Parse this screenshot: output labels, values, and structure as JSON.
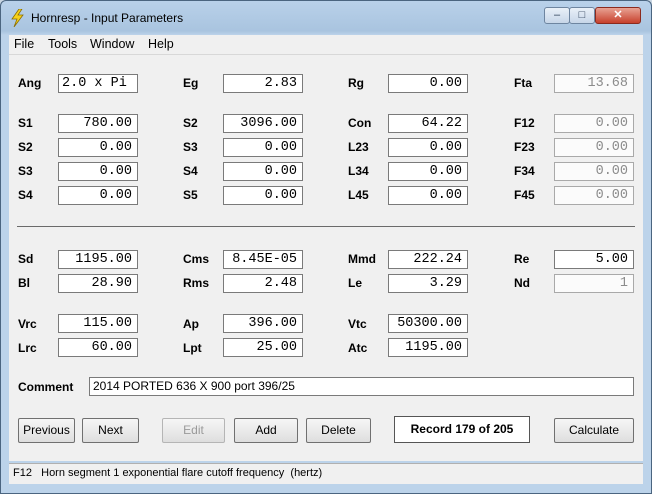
{
  "window": {
    "title": "Hornresp - Input Parameters"
  },
  "menu": [
    "File",
    "Tools",
    "Window",
    "Help"
  ],
  "row1": [
    {
      "label": "Ang",
      "value": "2.0 x Pi"
    },
    {
      "label": "Eg",
      "value": "2.83"
    },
    {
      "label": "Rg",
      "value": "0.00"
    },
    {
      "label": "Fta",
      "value": "13.68"
    }
  ],
  "horn": {
    "col1": [
      {
        "label": "S1",
        "value": "780.00"
      },
      {
        "label": "S2",
        "value": "0.00"
      },
      {
        "label": "S3",
        "value": "0.00"
      },
      {
        "label": "S4",
        "value": "0.00"
      }
    ],
    "col2": [
      {
        "label": "S2",
        "value": "3096.00"
      },
      {
        "label": "S3",
        "value": "0.00"
      },
      {
        "label": "S4",
        "value": "0.00"
      },
      {
        "label": "S5",
        "value": "0.00"
      }
    ],
    "col3": [
      {
        "label": "Con",
        "value": "64.22"
      },
      {
        "label": "L23",
        "value": "0.00"
      },
      {
        "label": "L34",
        "value": "0.00"
      },
      {
        "label": "L45",
        "value": "0.00"
      }
    ],
    "col4": [
      {
        "label": "F12",
        "value": "0.00"
      },
      {
        "label": "F23",
        "value": "0.00"
      },
      {
        "label": "F34",
        "value": "0.00"
      },
      {
        "label": "F45",
        "value": "0.00"
      }
    ]
  },
  "driver": {
    "sd": {
      "label": "Sd",
      "value": "1195.00"
    },
    "cms": {
      "label": "Cms",
      "value": "8.45E-05"
    },
    "mmd": {
      "label": "Mmd",
      "value": "222.24"
    },
    "re": {
      "label": "Re",
      "value": "5.00"
    },
    "bl": {
      "label": "Bl",
      "value": "28.90"
    },
    "rms": {
      "label": "Rms",
      "value": "2.48"
    },
    "le": {
      "label": "Le",
      "value": "3.29"
    },
    "nd": {
      "label": "Nd",
      "value": "1"
    }
  },
  "chamber": {
    "vrc": {
      "label": "Vrc",
      "value": "115.00"
    },
    "ap": {
      "label": "Ap",
      "value": "396.00"
    },
    "vtc": {
      "label": "Vtc",
      "value": "50300.00"
    },
    "lrc": {
      "label": "Lrc",
      "value": "60.00"
    },
    "lpt": {
      "label": "Lpt",
      "value": "25.00"
    },
    "atc": {
      "label": "Atc",
      "value": "1195.00"
    }
  },
  "comment": {
    "label": "Comment",
    "value": "2014 PORTED 636 X 900 port 396/25"
  },
  "buttons": {
    "previous": "Previous",
    "next": "Next",
    "edit": "Edit",
    "add": "Add",
    "delete": "Delete",
    "calculate": "Calculate"
  },
  "record": "Record 179 of 205",
  "status": "F12   Horn segment 1 exponential flare cutoff frequency  (hertz)",
  "colors": {
    "accent": "#b9d1ea",
    "client": "#f0f0f0",
    "close": "#c7402c"
  }
}
